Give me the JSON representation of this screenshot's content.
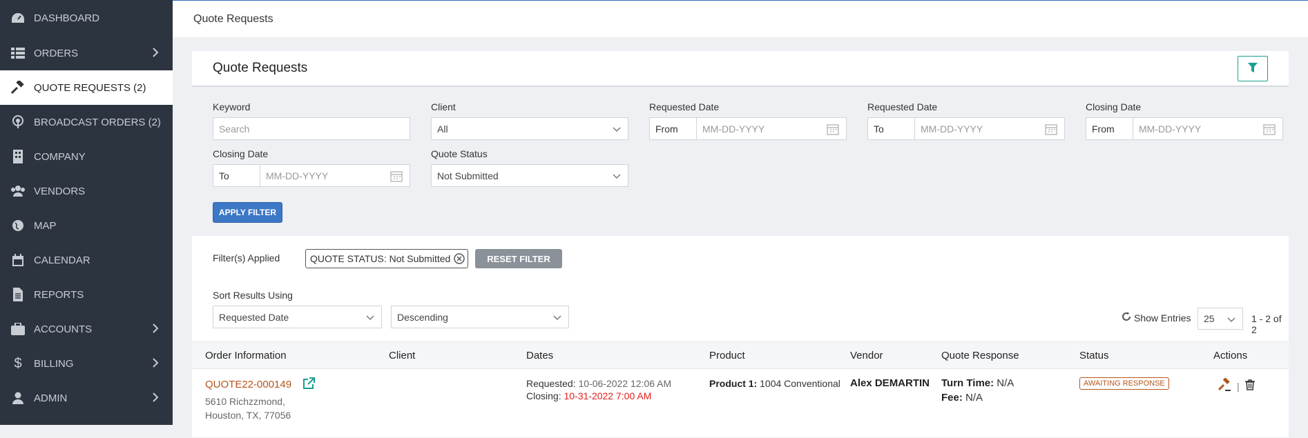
{
  "sidebar": {
    "items": [
      {
        "label": "DASHBOARD",
        "icon": "dashboard-icon"
      },
      {
        "label": "ORDERS",
        "icon": "list-icon",
        "chevron": true
      },
      {
        "label": "QUOTE REQUESTS (2)",
        "icon": "gavel-icon",
        "active": true
      },
      {
        "label": "BROADCAST ORDERS (2)",
        "icon": "broadcast-icon"
      },
      {
        "label": "COMPANY",
        "icon": "building-icon"
      },
      {
        "label": "VENDORS",
        "icon": "users-icon"
      },
      {
        "label": "MAP",
        "icon": "globe-icon"
      },
      {
        "label": "CALENDAR",
        "icon": "calendar-icon"
      },
      {
        "label": "REPORTS",
        "icon": "file-icon"
      },
      {
        "label": "ACCOUNTS",
        "icon": "briefcase-icon",
        "chevron": true
      },
      {
        "label": "BILLING",
        "icon": "dollar-icon",
        "chevron": true
      },
      {
        "label": "ADMIN",
        "icon": "user-icon",
        "chevron": true
      }
    ]
  },
  "breadcrumb": "Quote Requests",
  "panel": {
    "title": "Quote Requests"
  },
  "filters": {
    "keyword": {
      "label": "Keyword",
      "placeholder": "Search"
    },
    "client": {
      "label": "Client",
      "value": "All"
    },
    "requested_from": {
      "label": "Requested Date",
      "prefix": "From",
      "placeholder": "MM-DD-YYYY"
    },
    "requested_to": {
      "label": "Requested Date",
      "prefix": "To",
      "placeholder": "MM-DD-YYYY"
    },
    "closing_from": {
      "label": "Closing Date",
      "prefix": "From",
      "placeholder": "MM-DD-YYYY"
    },
    "closing_to": {
      "label": "Closing Date",
      "prefix": "To",
      "placeholder": "MM-DD-YYYY"
    },
    "quote_status": {
      "label": "Quote Status",
      "value": "Not Submitted"
    },
    "apply_label": "APPLY FILTER"
  },
  "applied": {
    "label": "Filter(s) Applied",
    "chip": "QUOTE STATUS: Not Submitted",
    "reset_label": "RESET FILTER"
  },
  "sort": {
    "label": "Sort Results Using",
    "field": "Requested Date",
    "direction": "Descending"
  },
  "entries": {
    "label": "Show Entries",
    "value": "25",
    "range": "1 - 2 of 2"
  },
  "table": {
    "headers": [
      "Order Information",
      "Client",
      "Dates",
      "Product",
      "Vendor",
      "Quote Response",
      "Status",
      "Actions"
    ],
    "rows": [
      {
        "order_id": "QUOTE22-000149",
        "address1": "5610 Richzzmond,",
        "address2": "Houston, TX, 77056",
        "client": "",
        "requested_label": "Requested:",
        "requested_value": "10-06-2022 12:06 AM",
        "closing_label": "Closing:",
        "closing_value": "10-31-2022 7:00 AM",
        "product_label": "Product 1:",
        "product_value": "1004 Conventional",
        "vendor": "Alex DEMARTIN",
        "turn_label": "Turn Time:",
        "turn_value": "N/A",
        "fee_label": "Fee:",
        "fee_value": "N/A",
        "status": "AWAITING RESPONSE"
      }
    ]
  },
  "colors": {
    "sidebar_bg": "#2c3440",
    "accent_teal": "#1a9e8f",
    "link_orange": "#b5541b",
    "apply_blue": "#3d78c7",
    "danger_red": "#e31c1c"
  }
}
